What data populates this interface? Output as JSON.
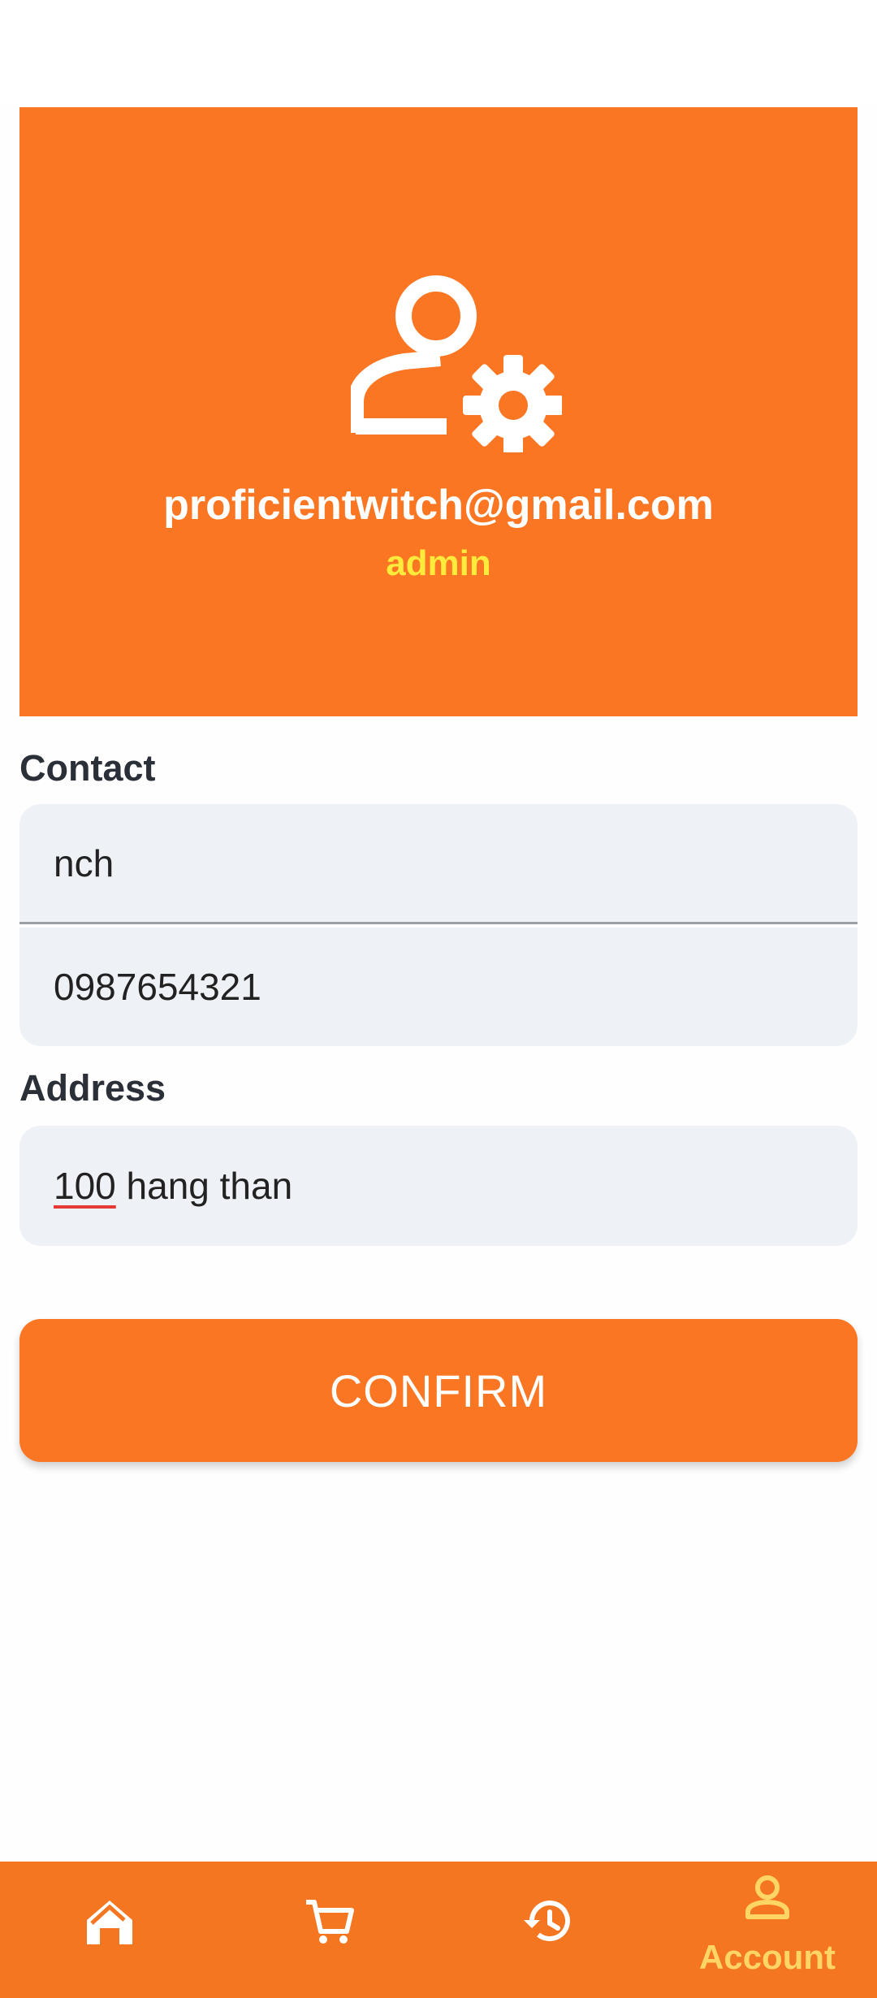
{
  "profile": {
    "email": "proficientwitch@gmail.com",
    "role": "admin",
    "icon": "manage-accounts-icon"
  },
  "contact": {
    "label": "Contact",
    "name_value": "nch",
    "phone_value": "0987654321"
  },
  "address": {
    "label": "Address",
    "value_underlined": "100",
    "value_rest": " hang than"
  },
  "confirm_label": "CONFIRM",
  "nav": {
    "items": [
      {
        "icon": "home-icon",
        "label": ""
      },
      {
        "icon": "cart-icon",
        "label": ""
      },
      {
        "icon": "history-icon",
        "label": ""
      },
      {
        "icon": "account-icon",
        "label": "Account"
      }
    ],
    "active_index": 3
  },
  "colors": {
    "primary": "#fb7623",
    "role": "#ffeb3b",
    "nav_active": "#ffd666",
    "field_bg": "#eef2f7"
  }
}
